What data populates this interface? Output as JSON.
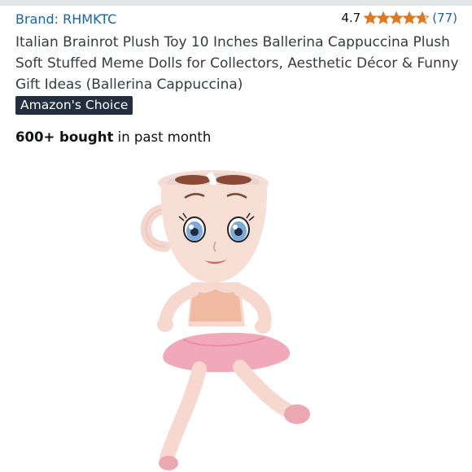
{
  "brand": {
    "label": "Brand: RHMKTC"
  },
  "rating": {
    "value": "4.7",
    "stars": 4.7,
    "count": "(77)",
    "star_color": "#de7921"
  },
  "product": {
    "title": "Italian Brainrot Plush Toy 10 Inches Ballerina Cappuccina Plush Soft Stuffed Meme Dolls for Collectors, Aesthetic Décor & Funny Gift Ideas (Ballerina Cappuccina)",
    "badge": "Amazon's Choice",
    "bought_bold": "600+ bought",
    "bought_rest": " in past month"
  },
  "colors": {
    "link": "#2162a1",
    "badge_bg": "#232f3e",
    "title": "#373b3c"
  }
}
